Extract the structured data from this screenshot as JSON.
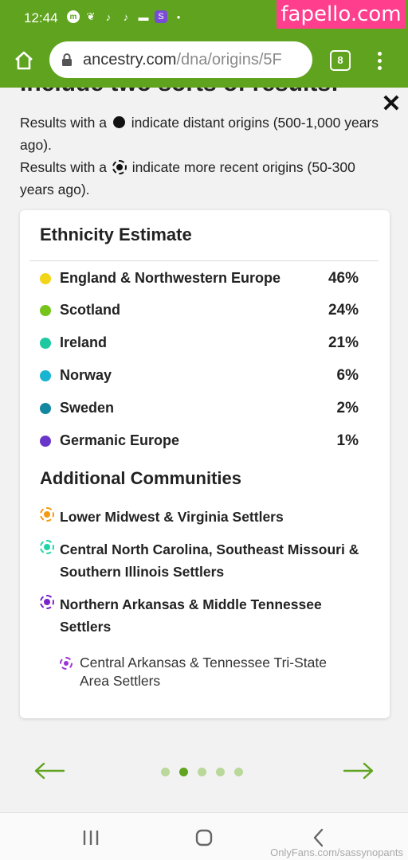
{
  "status": {
    "time": "12:44",
    "dot": "•"
  },
  "watermark": "fapello.com",
  "browser": {
    "url_domain": "ancestry.com",
    "url_path": "/dna/origins/5F",
    "tab_count": "8"
  },
  "intro": {
    "cut_heading": "include two sorts of results:",
    "line1_before": "Results with a",
    "line1_after": "indicate distant origins (500-1,000 years ago).",
    "line2_before": "Results with a",
    "line2_after": "indicate more recent origins (50-300 years ago)."
  },
  "card": {
    "title": "Ethnicity Estimate",
    "ethnicities": [
      {
        "name": "England & Northwestern Europe",
        "percent": "46%",
        "color": "#f2d517"
      },
      {
        "name": "Scotland",
        "percent": "24%",
        "color": "#76c41a"
      },
      {
        "name": "Ireland",
        "percent": "21%",
        "color": "#1ec8a0"
      },
      {
        "name": "Norway",
        "percent": "6%",
        "color": "#18b4d2"
      },
      {
        "name": "Sweden",
        "percent": "2%",
        "color": "#1287a0"
      },
      {
        "name": "Germanic Europe",
        "percent": "1%",
        "color": "#6a36c9"
      }
    ],
    "communities_title": "Additional Communities",
    "communities": [
      {
        "name": "Lower Midwest & Virginia Settlers",
        "color": "#f39a12"
      },
      {
        "name": "Central North Carolina, Southeast Missouri & Southern Illinois Settlers",
        "color": "#20d4a8"
      },
      {
        "name": "Northern Arkansas & Middle Tennessee Settlers",
        "color": "#7b22c9"
      }
    ],
    "sub_community": {
      "name": "Central Arkansas & Tennessee Tri-State Area Settlers",
      "color": "#9b33d6"
    }
  },
  "pager": {
    "total": 5,
    "active_index": 1
  },
  "footer_watermark": "OnlyFans.com/sassynopants",
  "colors": {
    "brand_green": "#5fa31e",
    "watermark_pink": "#ff3f8e"
  }
}
